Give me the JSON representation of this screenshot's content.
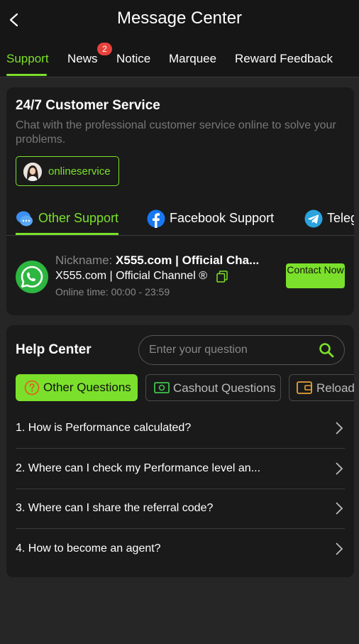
{
  "header": {
    "title": "Message Center"
  },
  "tabs": [
    {
      "label": "Support",
      "active": true
    },
    {
      "label": "News",
      "badge": "2"
    },
    {
      "label": "Notice"
    },
    {
      "label": "Marquee"
    },
    {
      "label": "Reward Feedback"
    }
  ],
  "customer_service": {
    "title": "24/7 Customer Service",
    "description": "Chat with the professional customer service online to solve your problems.",
    "online_button": "onlineservice"
  },
  "support_tabs": [
    {
      "label": "Other Support",
      "icon": "chat-bubble-icon",
      "active": true
    },
    {
      "label": "Facebook Support",
      "icon": "facebook-icon"
    },
    {
      "label": "Telegram Support",
      "icon": "telegram-icon"
    }
  ],
  "channel": {
    "nickname_key": "Nickname:",
    "nickname_value": "X555.com | Official Cha...",
    "name": "X555.com | Official Channel ®",
    "online_time_key": "Online time:",
    "online_time_value": "00:00 - 23:59",
    "contact_label": "Contact Now",
    "icon": "whatsapp-icon"
  },
  "help_center": {
    "title": "Help Center",
    "search_placeholder": "Enter your question",
    "categories": [
      {
        "label": "Other Questions",
        "icon": "question-circle-icon",
        "active": true
      },
      {
        "label": "Cashout Questions",
        "icon": "cash-icon"
      },
      {
        "label": "Reload Questions",
        "icon": "wallet-icon"
      }
    ],
    "questions": [
      "1. How is Performance calculated?",
      "2. Where can I check my Performance level an...",
      "3. Where can I share the referral code?",
      "4. How to become an agent?"
    ]
  },
  "colors": {
    "accent": "#7be02b",
    "background": "#262626",
    "header": "#161616",
    "card": "#1a1a1a",
    "badge": "#e8413b",
    "whatsapp": "#2db640",
    "facebook": "#1877f2",
    "telegram": "#2aa3df"
  }
}
